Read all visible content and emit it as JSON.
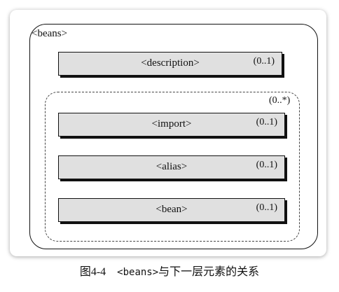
{
  "diagram": {
    "root_label": "<beans>",
    "description": {
      "label": "<description>",
      "multiplicity": "(0..1)"
    },
    "group_multiplicity": "(0..*)",
    "children": [
      {
        "label": "<import>",
        "multiplicity": "(0..1)"
      },
      {
        "label": "<alias>",
        "multiplicity": "(0..1)"
      },
      {
        "label": "<bean>",
        "multiplicity": "(0..1)"
      }
    ]
  },
  "caption": {
    "figure": "图4-4",
    "code": "<beans>",
    "text": "与下一层元素的关系"
  }
}
